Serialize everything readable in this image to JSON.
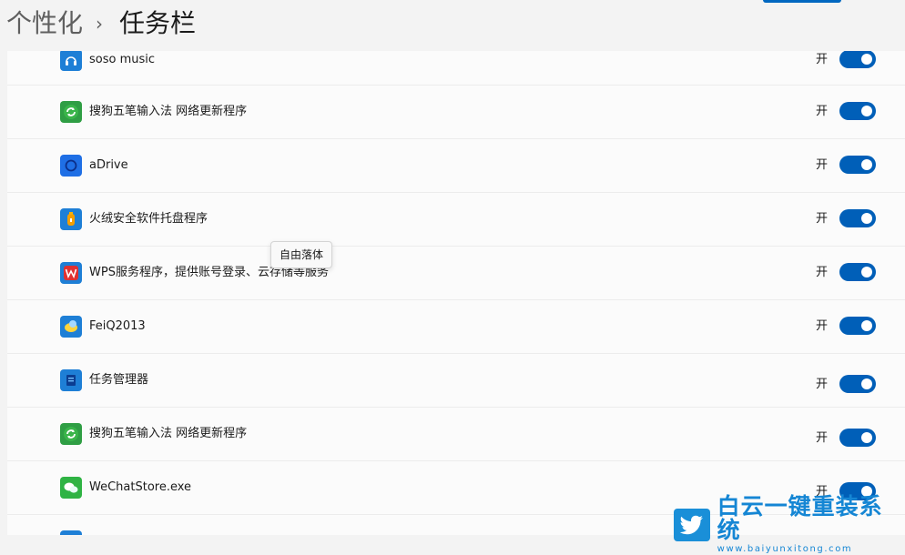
{
  "header": {
    "breadcrumb_parent": "个性化",
    "breadcrumb_separator": "›",
    "breadcrumb_current": "任务栏"
  },
  "toggle_color": "#005fb8",
  "apps": [
    {
      "name": "soso music",
      "state": "开",
      "icon": "music-app-icon"
    },
    {
      "name": "搜狗五笔输入法 网络更新程序",
      "state": "开",
      "icon": "sogou-update-icon"
    },
    {
      "name": "aDrive",
      "state": "开",
      "icon": "adrive-icon"
    },
    {
      "name": "火绒安全软件托盘程序",
      "state": "开",
      "icon": "huorong-icon"
    },
    {
      "name": "WPS服务程序，提供账号登录、云存储等服务",
      "state": "开",
      "icon": "wps-icon"
    },
    {
      "name": "FeiQ2013",
      "state": "开",
      "icon": "feiq-icon"
    },
    {
      "name": "任务管理器",
      "state": "开",
      "icon": "task-manager-icon"
    },
    {
      "name": "搜狗五笔输入法 网络更新程序",
      "state": "开",
      "icon": "sogou-update-icon"
    },
    {
      "name": "WeChatStore.exe",
      "state": "开",
      "icon": "wechat-icon"
    }
  ],
  "tooltip": {
    "text": "自由落体"
  },
  "watermark": {
    "title": "白云一键重装系统",
    "url": "www.baiyunxitong.com",
    "icon": "bird-logo-icon"
  }
}
